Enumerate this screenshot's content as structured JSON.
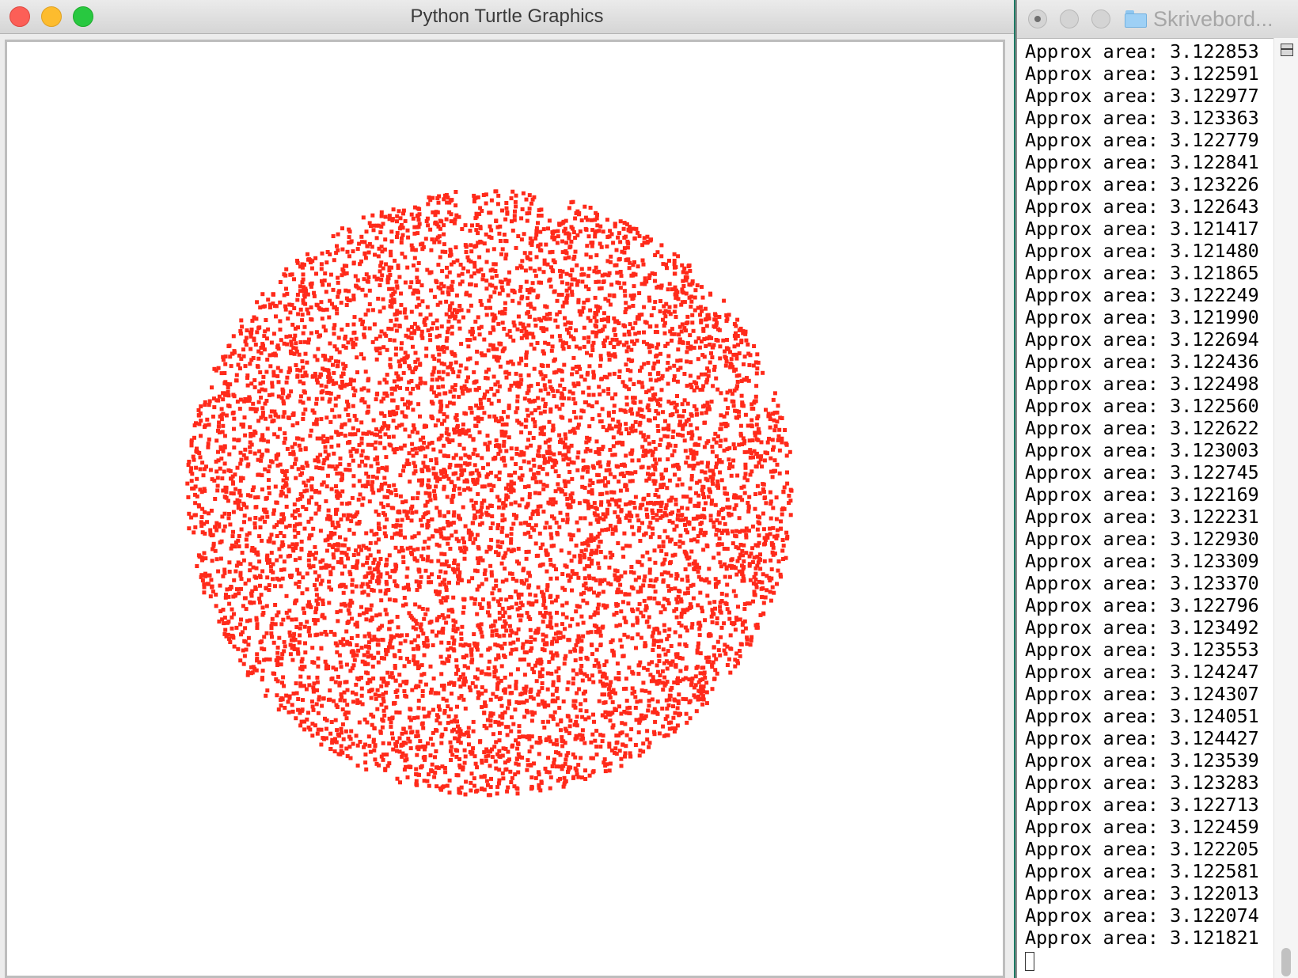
{
  "turtle_window": {
    "title": "Python Turtle Graphics",
    "dot_color": "#ff2a1a",
    "icons": [
      "close-button",
      "minimize-button",
      "zoom-button"
    ]
  },
  "terminal_window": {
    "title": "Skrivebord...",
    "icons": [
      "close-button",
      "minimize-button",
      "zoom-button",
      "folder-icon",
      "split-pane-icon"
    ],
    "lines": [
      "Approx area: 3.122853",
      "Approx area: 3.122591",
      "Approx area: 3.122977",
      "Approx area: 3.123363",
      "Approx area: 3.122779",
      "Approx area: 3.122841",
      "Approx area: 3.123226",
      "Approx area: 3.122643",
      "Approx area: 3.121417",
      "Approx area: 3.121480",
      "Approx area: 3.121865",
      "Approx area: 3.122249",
      "Approx area: 3.121990",
      "Approx area: 3.122694",
      "Approx area: 3.122436",
      "Approx area: 3.122498",
      "Approx area: 3.122560",
      "Approx area: 3.122622",
      "Approx area: 3.123003",
      "Approx area: 3.122745",
      "Approx area: 3.122169",
      "Approx area: 3.122231",
      "Approx area: 3.122930",
      "Approx area: 3.123309",
      "Approx area: 3.123370",
      "Approx area: 3.122796",
      "Approx area: 3.123492",
      "Approx area: 3.123553",
      "Approx area: 3.124247",
      "Approx area: 3.124307",
      "Approx area: 3.124051",
      "Approx area: 3.124427",
      "Approx area: 3.123539",
      "Approx area: 3.123283",
      "Approx area: 3.122713",
      "Approx area: 3.122459",
      "Approx area: 3.122205",
      "Approx area: 3.122581",
      "Approx area: 3.122013",
      "Approx area: 3.122074",
      "Approx area: 3.121821"
    ]
  }
}
